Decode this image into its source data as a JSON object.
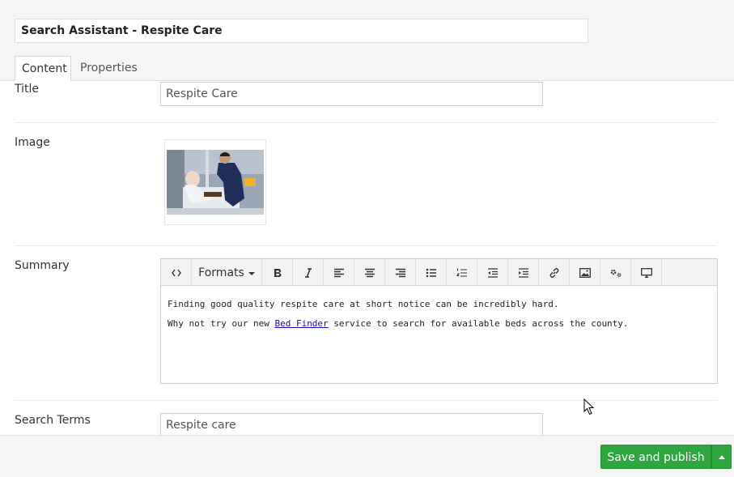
{
  "header": {
    "name_value": "Search Assistant - Respite Care",
    "tabs": [
      {
        "label": "Content",
        "active": true
      },
      {
        "label": "Properties",
        "active": false
      }
    ]
  },
  "fields": {
    "title": {
      "label": "Title",
      "value": "Respite Care"
    },
    "image": {
      "label": "Image",
      "icon": "photo-thumbnail-icon"
    },
    "summary": {
      "label": "Summary",
      "toolbar": {
        "formats_label": "Formats",
        "buttons": [
          "source-code-icon",
          "bold-icon",
          "italic-icon",
          "align-left-icon",
          "align-center-icon",
          "align-right-icon",
          "bullet-list-icon",
          "numbered-list-icon",
          "outdent-icon",
          "indent-icon",
          "link-icon",
          "insert-image-icon",
          "macro-icon",
          "embed-icon"
        ]
      },
      "paragraph1": "Finding good quality respite care at short notice can be incredibly hard.",
      "paragraph2_before": "Why not try our new ",
      "paragraph2_link": "Bed Finder",
      "paragraph2_after": " service to search for available beds across the county."
    },
    "search_terms": {
      "label": "Search Terms",
      "value": "Respite care"
    }
  },
  "footer": {
    "publish_label": "Save and publish"
  },
  "colors": {
    "accent_green": "#2fa540",
    "link": "#1a0dab"
  }
}
